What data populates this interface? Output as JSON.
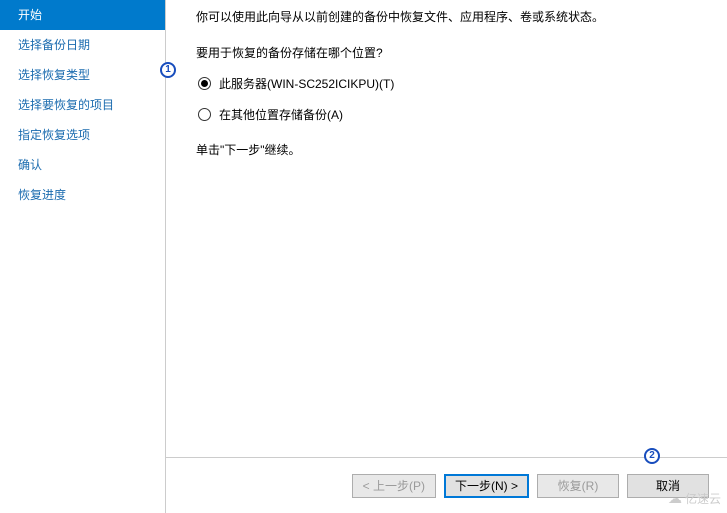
{
  "sidebar": {
    "items": [
      {
        "label": "开始",
        "active": true
      },
      {
        "label": "选择备份日期",
        "active": false
      },
      {
        "label": "选择恢复类型",
        "active": false
      },
      {
        "label": "选择要恢复的项目",
        "active": false
      },
      {
        "label": "指定恢复选项",
        "active": false
      },
      {
        "label": "确认",
        "active": false
      },
      {
        "label": "恢复进度",
        "active": false
      }
    ]
  },
  "main": {
    "intro": "你可以使用此向导从以前创建的备份中恢复文件、应用程序、卷或系统状态。",
    "question": "要用于恢复的备份存储在哪个位置?",
    "radio": [
      {
        "label": "此服务器(WIN-SC252ICIKPU)(T)",
        "selected": true
      },
      {
        "label": "在其他位置存储备份(A)",
        "selected": false
      }
    ],
    "continue": "单击\"下一步\"继续。"
  },
  "buttons": {
    "prev": "< 上一步(P)",
    "next": "下一步(N) >",
    "recover": "恢复(R)",
    "cancel": "取消"
  },
  "annotations": {
    "one": "1",
    "two": "2"
  },
  "watermark": "亿速云"
}
